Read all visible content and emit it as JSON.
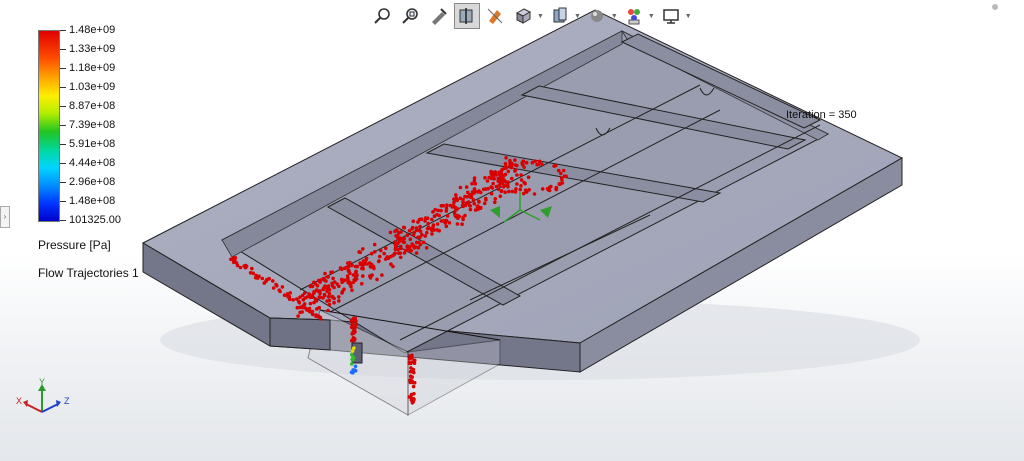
{
  "toolbar": {
    "icons": [
      "zoom-to-fit-icon",
      "zoom-to-area-icon",
      "previous-view-icon",
      "section-view-icon",
      "view-orientation-icon",
      "display-style-icon",
      "hide-show-items-icon",
      "edit-appearance-icon",
      "apply-scene-icon",
      "view-settings-icon"
    ]
  },
  "legend": {
    "labels": [
      "1.48e+09",
      "1.33e+09",
      "1.18e+09",
      "1.03e+09",
      "8.87e+08",
      "7.39e+08",
      "5.91e+08",
      "4.44e+08",
      "2.96e+08",
      "1.48e+08",
      "101325.00"
    ],
    "colors": [
      "#e00000",
      "#ff4a00",
      "#ff9f00",
      "#ffee00",
      "#b6ee00",
      "#21c421",
      "#00d9a3",
      "#00d4ff",
      "#0088ff",
      "#0033ff",
      "#0000cc"
    ],
    "title": "Pressure [Pa]",
    "subtitle": "Flow Trajectories 1"
  },
  "iteration": "Iteration = 350",
  "axes": {
    "x": "X",
    "y": "Y",
    "z": "Z"
  },
  "model_colors": {
    "top": "#a5a8bb",
    "right": "#8c8ea2",
    "front": "#76788c",
    "trajectory": "#d80000"
  }
}
